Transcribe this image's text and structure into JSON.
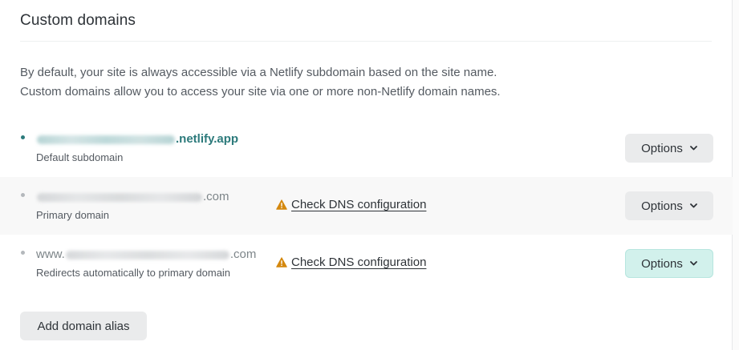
{
  "section": {
    "title": "Custom domains",
    "description_lines": [
      "By default, your site is always accessible via a Netlify subdomain based on the site name.",
      "Custom domains allow you to access your site via one or more non-Netlify domain names."
    ]
  },
  "domains": [
    {
      "prefix": "",
      "suffix": ".netlify.app",
      "label": "Default subdomain",
      "options_label": "Options",
      "dns_link": null
    },
    {
      "prefix": "",
      "suffix": ".com",
      "label": "Primary domain",
      "options_label": "Options",
      "dns_link": "Check DNS configuration"
    },
    {
      "prefix": "www.",
      "suffix": ".com",
      "label": "Redirects automatically to primary domain",
      "options_label": "Options",
      "dns_link": "Check DNS configuration"
    }
  ],
  "add_button_label": "Add domain alias",
  "colors": {
    "link_teal": "#2c7a7b",
    "warning": "#d4880f",
    "options_active_bg": "#d2f1ec"
  },
  "icons": {
    "bullet": "bullet-icon",
    "warning": "warning-icon",
    "options_chevron": "chevron-down-icon"
  }
}
